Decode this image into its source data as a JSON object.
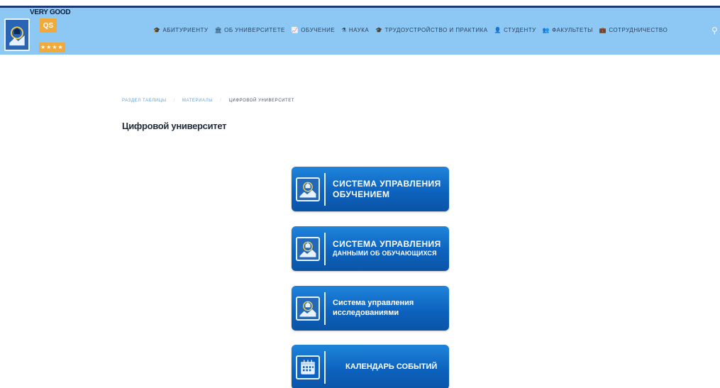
{
  "logo": {
    "badge_text": "VERY GOOD",
    "qs_text": "QS",
    "stars": "★★★★"
  },
  "nav": {
    "items": [
      {
        "label": "АБИТУРИЕНТУ",
        "icon": "graduation-cap-icon",
        "glyph": "🎓"
      },
      {
        "label": "ОБ УНИВЕРСИТЕТЕ",
        "icon": "university-icon",
        "glyph": "🏛"
      },
      {
        "label": "ОБУЧЕНИЕ",
        "icon": "chart-icon",
        "glyph": "📈"
      },
      {
        "label": "НАУКА",
        "icon": "flask-icon",
        "glyph": "⚗"
      },
      {
        "label": "ТРУДОУСТРОЙСТВО И ПРАКТИКА",
        "icon": "mortarboard-icon",
        "glyph": "🎓"
      },
      {
        "label": "СТУДЕНТУ",
        "icon": "student-icon",
        "glyph": "👤"
      },
      {
        "label": "ФАКУЛЬТЕТЫ",
        "icon": "people-icon",
        "glyph": "👥"
      },
      {
        "label": "СОТРУДНИЧЕСТВО",
        "icon": "briefcase-icon",
        "glyph": "💼"
      }
    ],
    "search_glyph": "⚲"
  },
  "breadcrumb": {
    "items": [
      "РАЗДЕЛ ТАБЛИЦЫ",
      "МАТЕРИАЛЫ"
    ],
    "current": "ЦИФРОВОЙ УНИВЕРСИТЕТ",
    "separator": "/"
  },
  "page": {
    "title": "Цифровой университет"
  },
  "tiles": [
    {
      "line1": "СИСТЕМА УПРАВЛЕНИЯ",
      "line2": "ОБУЧЕНИЕМ",
      "icon": "university-emblem-icon"
    },
    {
      "line1": "СИСТЕМА УПРАВЛЕНИЯ",
      "line2": "ДАННЫМИ ОБ ОБУЧАЮЩИХСЯ",
      "icon": "university-emblem-icon"
    },
    {
      "line1": "Система управления",
      "line2": "исследованиями",
      "icon": "university-emblem-icon"
    },
    {
      "line1": "КАЛЕНДАРЬ СОБЫТИЙ",
      "icon": "calendar-icon"
    }
  ],
  "colors": {
    "header_bg": "#8dc8f4",
    "tile_blue": "#0d63bf",
    "accent_orange": "#f1a93a"
  }
}
